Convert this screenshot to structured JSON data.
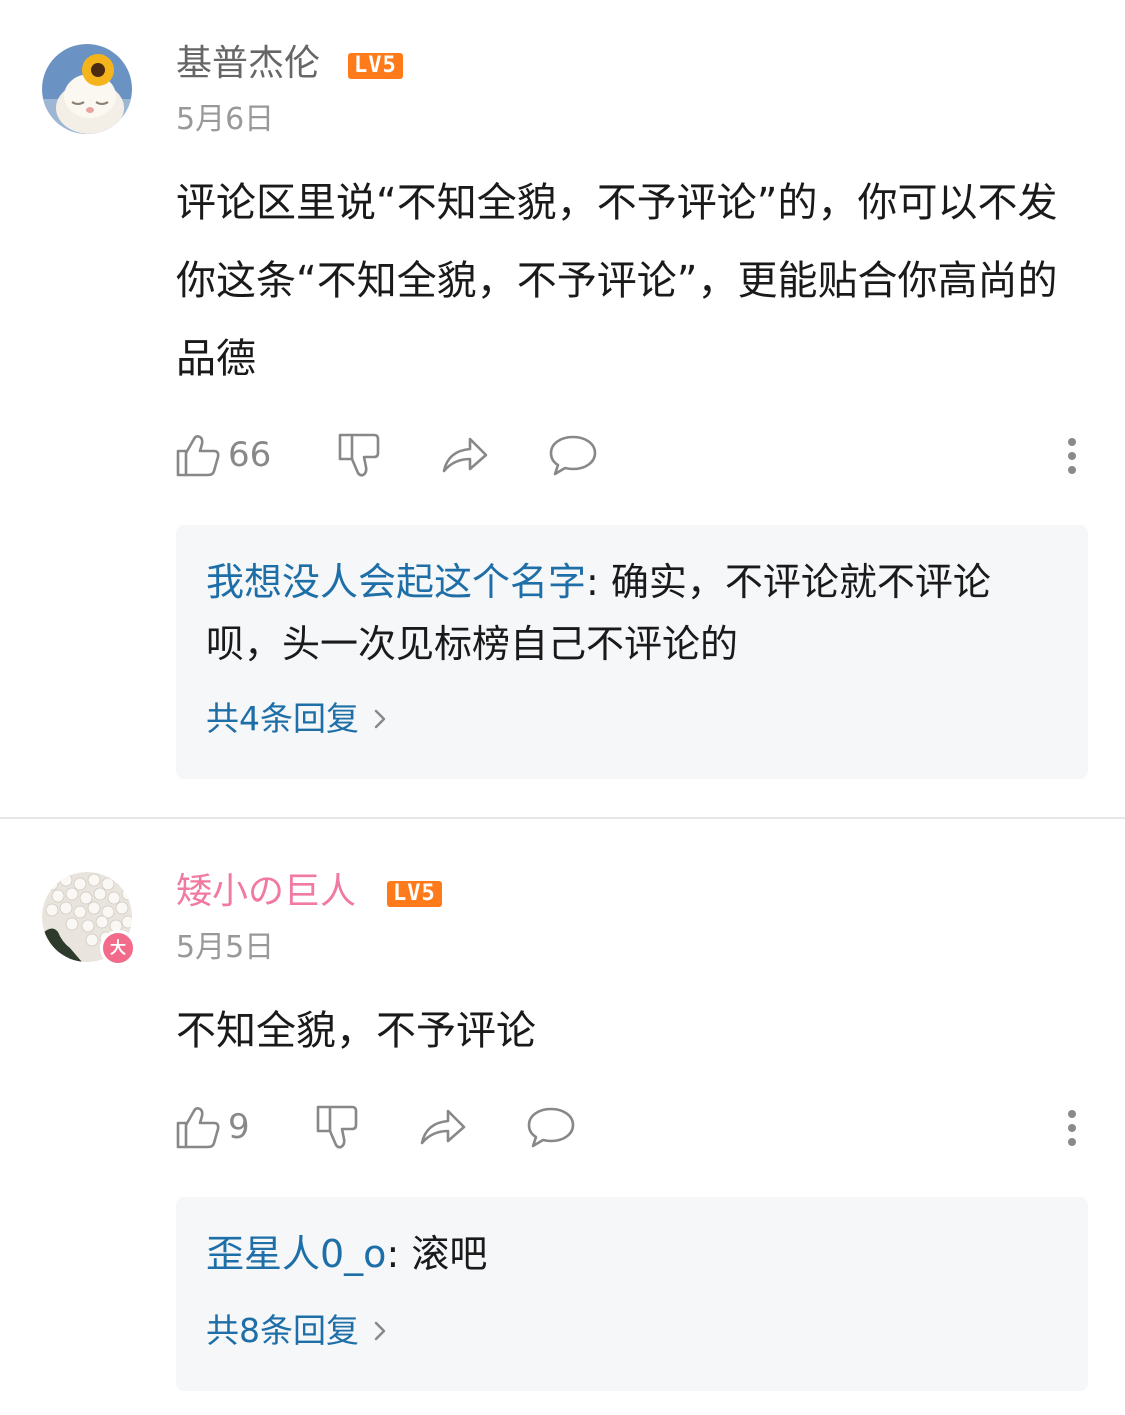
{
  "comments": [
    {
      "username": "基普杰伦",
      "level": "LV5",
      "date": "5月6日",
      "content": "评论区里说“不知全貌，不予评论”的，你可以不发你这条“不知全貌，不予评论”，更能贴合你高尚的品德",
      "likes": "66",
      "reply": {
        "user": "我想没人会起这个名字",
        "separator": ": ",
        "text": "确实，不评论就不评论呗，头一次见标榜自己不评论的",
        "count_label": "共4条回复"
      }
    },
    {
      "username": "矮小の巨人",
      "level": "LV5",
      "badge": "大",
      "date": "5月5日",
      "content": "不知全貌，不予评论",
      "likes": "9",
      "reply": {
        "user": "歪星人0_o",
        "separator": ": ",
        "text": "滚吧",
        "count_label": "共8条回复"
      }
    }
  ],
  "colors": {
    "username_default": "#666666",
    "username_vip": "#f07aa0",
    "level_badge": "#ff7a1a",
    "reply_link": "#1e6fa8"
  },
  "icons": [
    "thumbs-up-icon",
    "thumbs-down-icon",
    "share-icon",
    "comment-icon",
    "more-icon",
    "chevron-right-icon"
  ]
}
